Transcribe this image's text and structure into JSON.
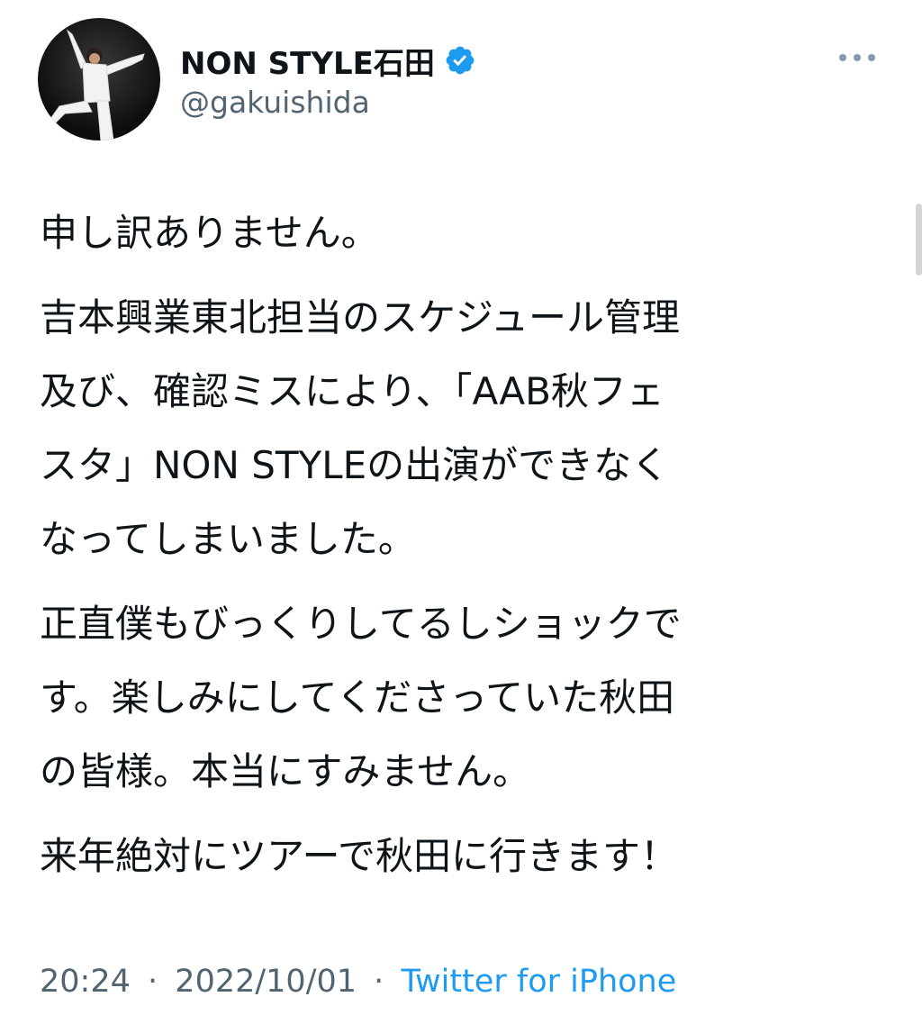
{
  "header": {
    "display_name": "NON STYLE石田",
    "handle": "@gakuishida",
    "avatar_icon": "profile-photo",
    "verified_icon": "verified-badge-icon",
    "more_icon": "more-options-icon"
  },
  "tweet": {
    "paragraphs": [
      "申し訳ありません。",
      "吉本興業東北担当のスケジュール管理\n及び、確認ミスにより、「AAB秋フェ\nスタ」NON STYLEの出演ができなく\nなってしまいました。",
      "正直僕もびっくりしてるしショックで\nす。楽しみにしてくださっていた秋田\nの皆様。本当にすみません。",
      "来年絶対にツアーで秋田に行きます！"
    ]
  },
  "meta": {
    "time": "20:24",
    "date": "2022/10/01",
    "separator": "·",
    "source": "Twitter for iPhone"
  },
  "colors": {
    "text": "#0f1419",
    "secondary": "#536471",
    "accent": "#1d9bf0"
  }
}
